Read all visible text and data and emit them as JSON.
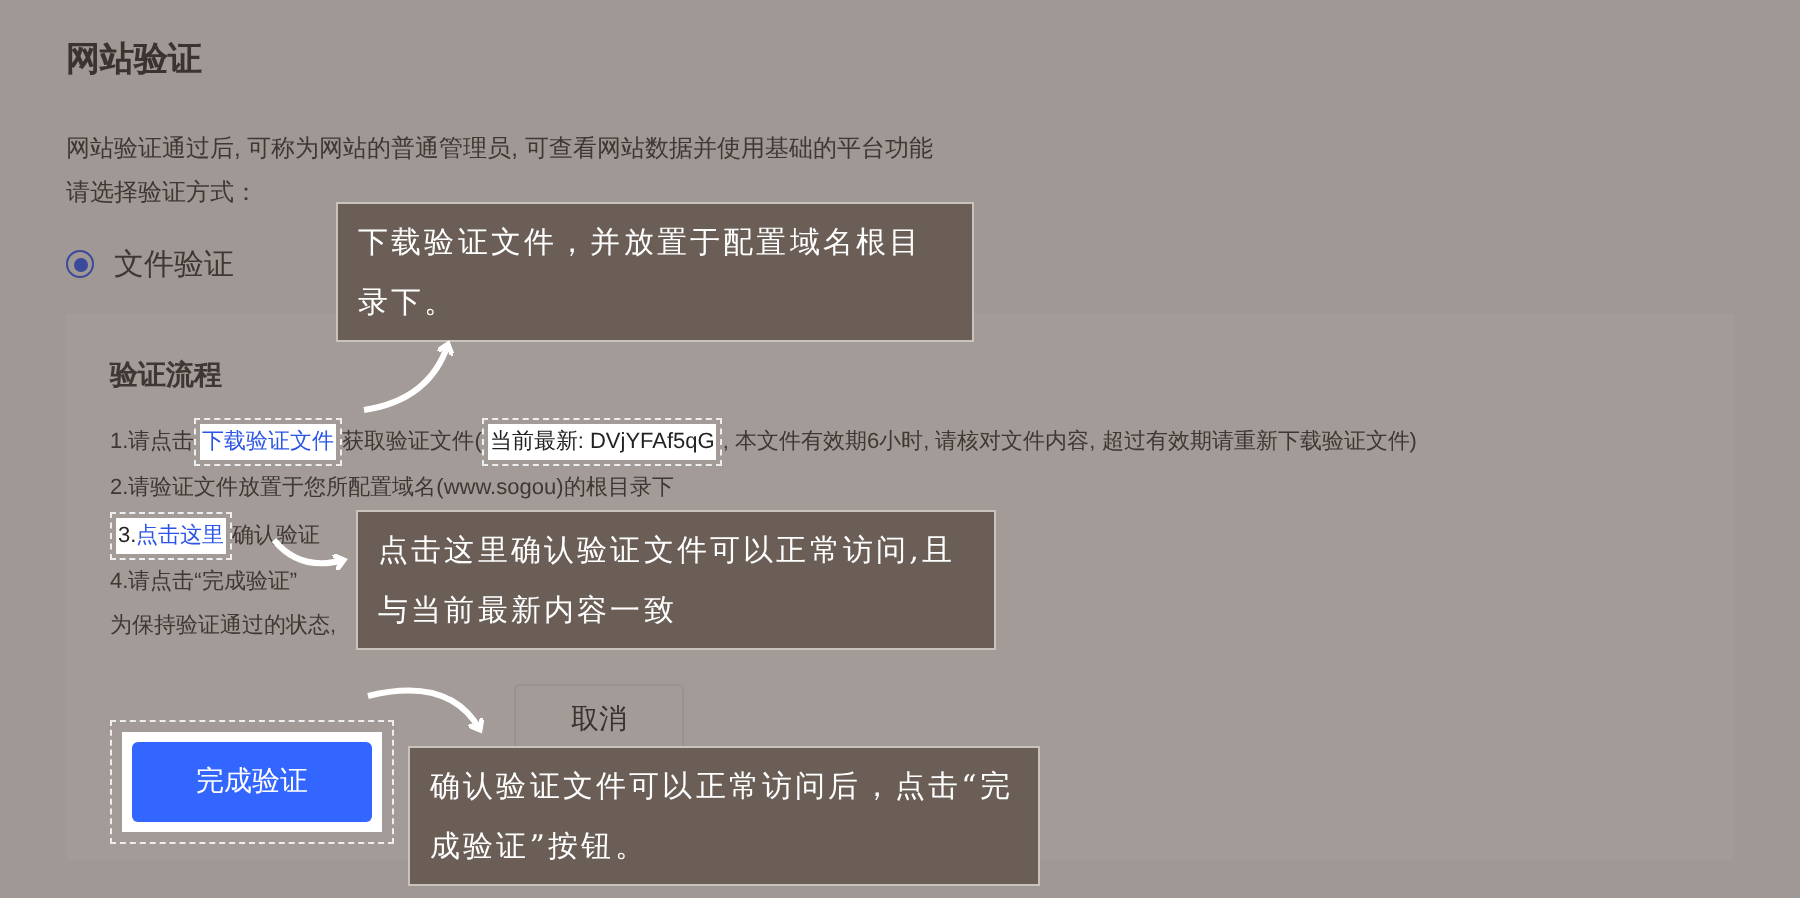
{
  "page": {
    "title": "网站验证",
    "description": "网站验证通过后, 可称为网站的普通管理员, 可查看网站数据并使用基础的平台功能",
    "method_prompt": "请选择验证方式："
  },
  "methods": [
    {
      "label": "文件验证",
      "selected": true
    }
  ],
  "process": {
    "title": "验证流程",
    "steps": [
      {
        "parts": [
          {
            "kind": "text",
            "text": "1.请点击"
          },
          {
            "kind": "highlight",
            "parts": [
              {
                "kind": "link",
                "text": "下载验证文件"
              }
            ]
          },
          {
            "kind": "text",
            "text": "获取验证文件("
          },
          {
            "kind": "highlight",
            "parts": [
              {
                "kind": "text",
                "text": "当前最新: DVjYFAf5qG"
              }
            ]
          },
          {
            "kind": "text",
            "text": ", 本文件有效期6小时, 请核对文件内容, 超过有效期请重新下载验证文件)"
          }
        ]
      },
      {
        "parts": [
          {
            "kind": "text",
            "text": "2.请验证文件放置于您所配置域名(www.sogou)的根目录下"
          }
        ]
      },
      {
        "parts": [
          {
            "kind": "highlight",
            "parts": [
              {
                "kind": "text",
                "text": "3."
              },
              {
                "kind": "link",
                "text": "点击这里"
              }
            ]
          },
          {
            "kind": "text",
            "text": "确认验证"
          }
        ]
      },
      {
        "parts": [
          {
            "kind": "text",
            "text": "4.请点击“完成验证”"
          }
        ]
      },
      {
        "parts": [
          {
            "kind": "text",
            "text": "为保持验证通过的状态,"
          }
        ]
      }
    ]
  },
  "buttons": [
    {
      "label": "完成验证",
      "kind": "primary",
      "highlighted": true
    },
    {
      "label": "取消",
      "kind": "secondary",
      "highlighted": false
    }
  ],
  "callouts": [
    {
      "text": "下载验证文件，并放置于配置域名根目录下。"
    },
    {
      "text": "点击这里确认验证文件可以正常访问,且与当前最新内容一致"
    },
    {
      "text": "确认验证文件可以正常访问后，点击“完成验证”按钮。"
    }
  ]
}
